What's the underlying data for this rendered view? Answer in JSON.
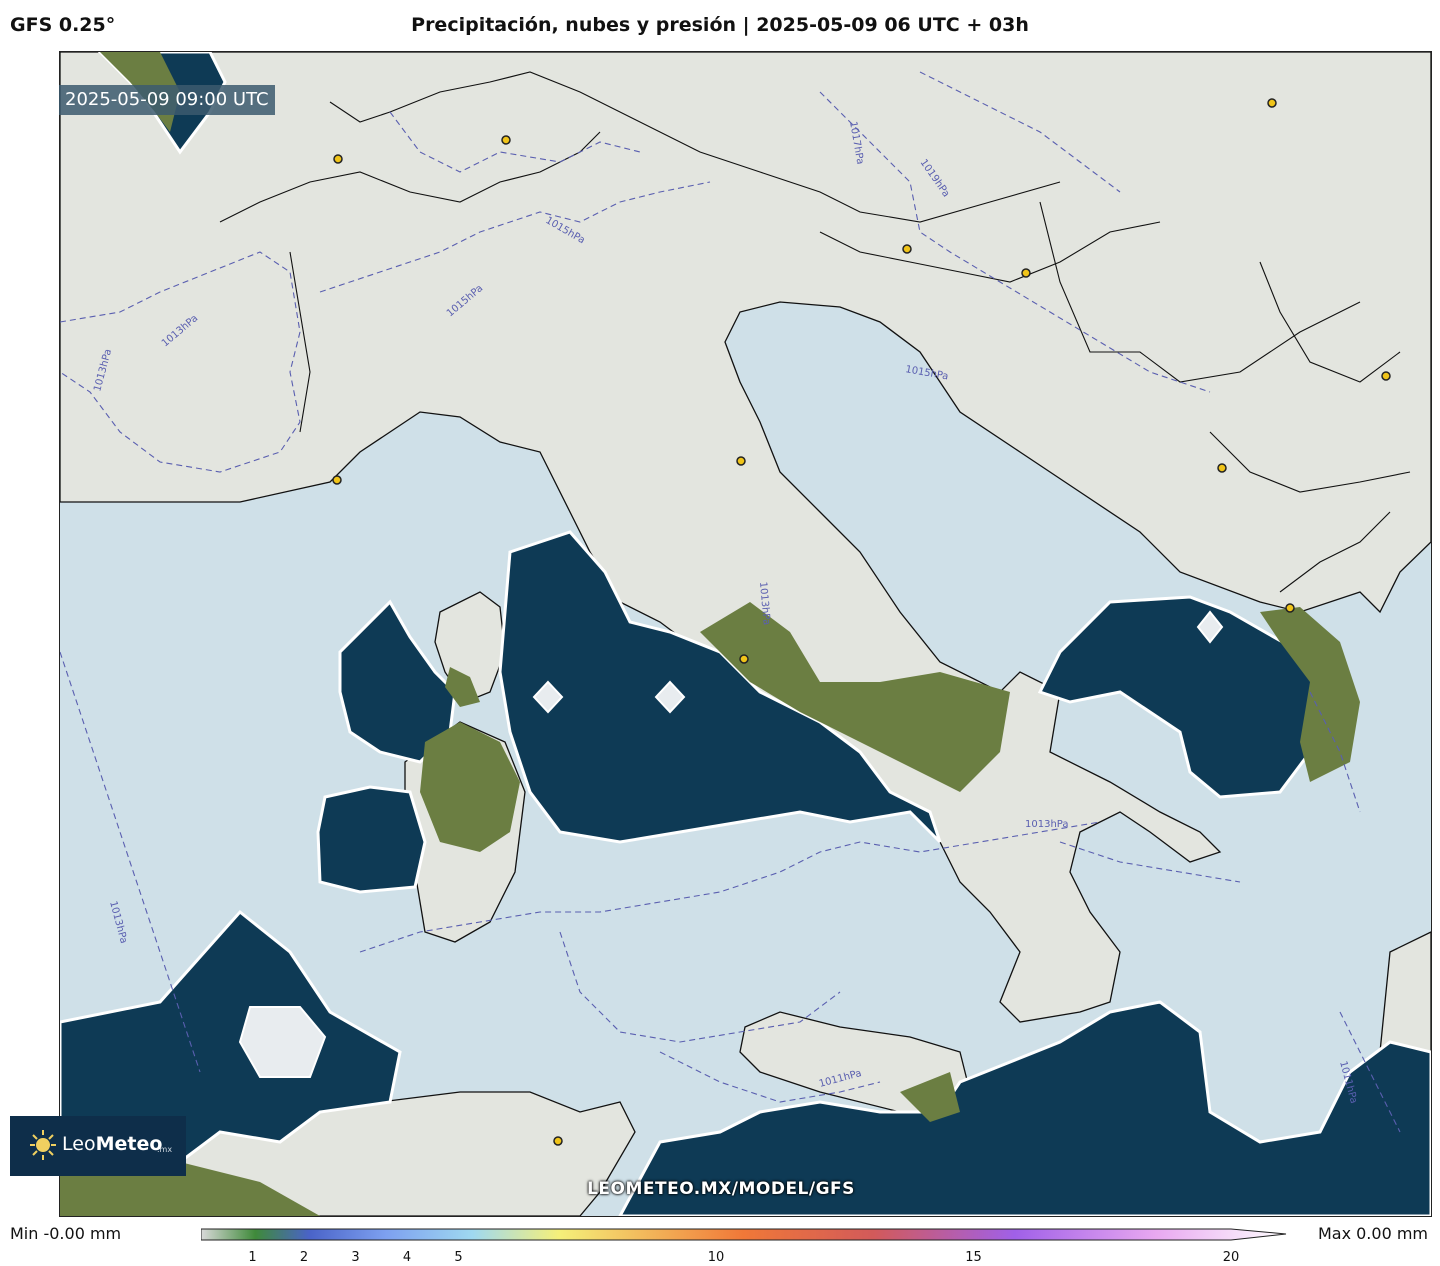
{
  "header": {
    "model": "GFS 0.25°",
    "title": "Precipitación, nubes y presión | 2025-05-09 06 UTC + 03h"
  },
  "map": {
    "timestamp": "2025-05-09 09:00 UTC",
    "isobar_labels": [
      "1013hPa",
      "1013hPa",
      "1015hPa",
      "1015hPa",
      "1017hPa",
      "1019hPa",
      "1015hPa",
      "1013hPa",
      "1011hPa",
      "1013hPa",
      "1013hPa",
      "1011hPa"
    ],
    "colors": {
      "sea": "#cfe0e8",
      "land_cloud": "#e4e6e0",
      "precip_area": "#0e3a55",
      "land_terrain": "#5f7a3c",
      "isobar": "#5a5fb0",
      "city_marker": "#f0c419"
    },
    "watermark": "LEOMETEO.MX/MODEL/GFS"
  },
  "logo": {
    "brand_light": "Leo",
    "brand_bold": "Meteo",
    "tld": ".mx"
  },
  "legend": {
    "min_label": "Min -0.00 mm",
    "max_label": "Max 0.00 mm",
    "ticks": [
      "1",
      "2",
      "3",
      "4",
      "5",
      "10",
      "15",
      "20"
    ],
    "tick_values": [
      1,
      2,
      3,
      4,
      5,
      10,
      15,
      20
    ],
    "range": [
      0,
      20
    ]
  }
}
